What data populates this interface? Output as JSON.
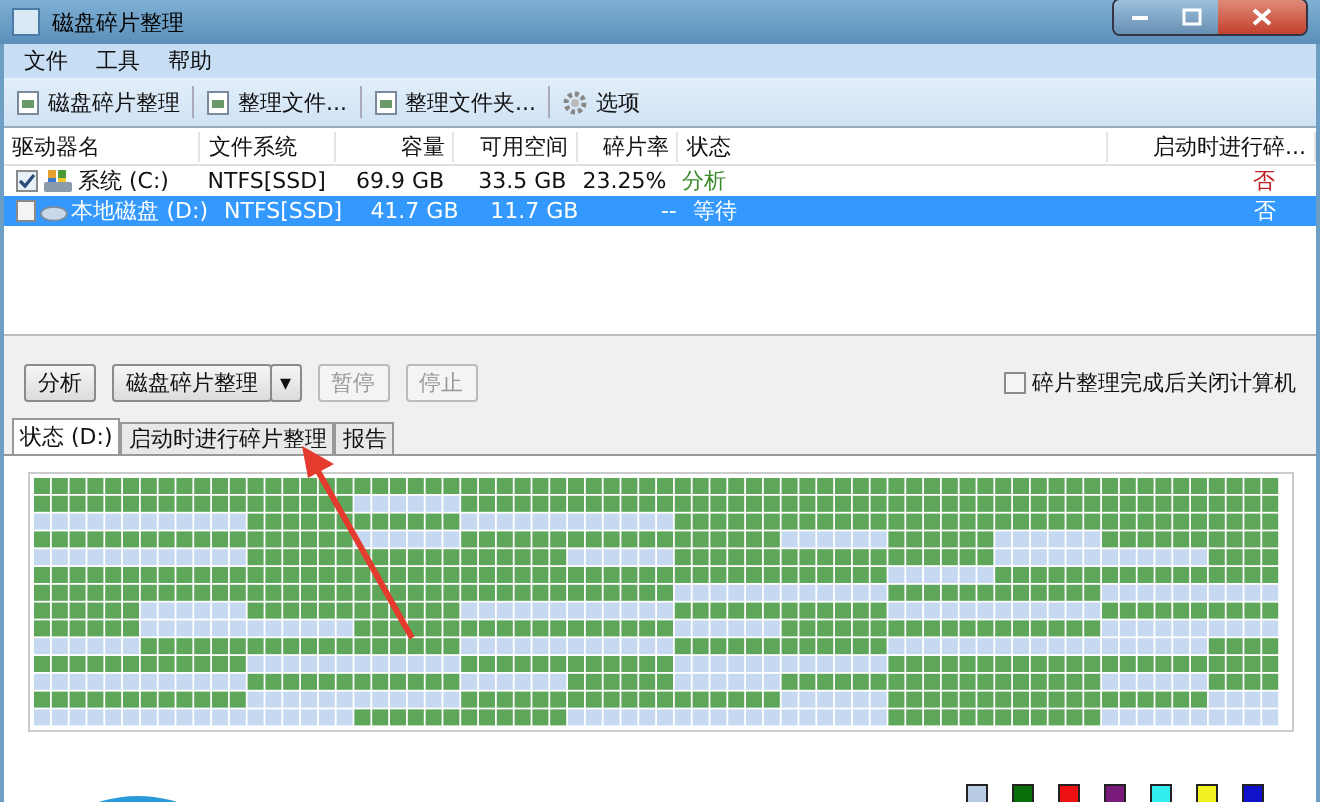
{
  "window": {
    "title": "磁盘碎片整理"
  },
  "menu": [
    "文件",
    "工具",
    "帮助"
  ],
  "toolbar": [
    "磁盘碎片整理",
    "整理文件...",
    "整理文件夹...",
    "选项"
  ],
  "table": {
    "columns": [
      "驱动器名",
      "文件系统",
      "容量",
      "可用空间",
      "碎片率",
      "状态",
      "启动时进行碎..."
    ],
    "rows": [
      {
        "name": "系统 (C:)",
        "fs": "NTFS[SSD]",
        "capacity": "69.9 GB",
        "free": "33.5 GB",
        "frag": "23.25%",
        "status": "分析",
        "boot": "否",
        "checked": true,
        "selected": false,
        "kind": "system"
      },
      {
        "name": "本地磁盘 (D:)",
        "fs": "NTFS[SSD]",
        "capacity": "41.7 GB",
        "free": "11.7 GB",
        "frag": "--",
        "status": "等待",
        "boot": "否",
        "checked": false,
        "selected": true,
        "kind": "local"
      }
    ]
  },
  "actions": [
    {
      "label": "分析",
      "disabled": false
    },
    {
      "label": "磁盘碎片整理",
      "disabled": false,
      "dropdown": "▾"
    },
    {
      "label": "暂停",
      "disabled": true
    },
    {
      "label": "停止",
      "disabled": true
    }
  ],
  "shutdown_option": {
    "label": "碎片整理完成后关闭计算机",
    "checked": false
  },
  "tabs": [
    {
      "label": "状态 (D:)",
      "selected": true
    },
    {
      "label": "启动时进行碎片整理",
      "selected": false
    },
    {
      "label": "报告",
      "selected": false
    }
  ],
  "legend": [
    {
      "color": "#b8cce4"
    },
    {
      "color": "#0a6e0a"
    },
    {
      "color": "#ee1111"
    },
    {
      "color": "#7a1a7a"
    },
    {
      "color": "#33eeee"
    },
    {
      "color": "#f2f222"
    },
    {
      "color": "#1111cc"
    }
  ]
}
